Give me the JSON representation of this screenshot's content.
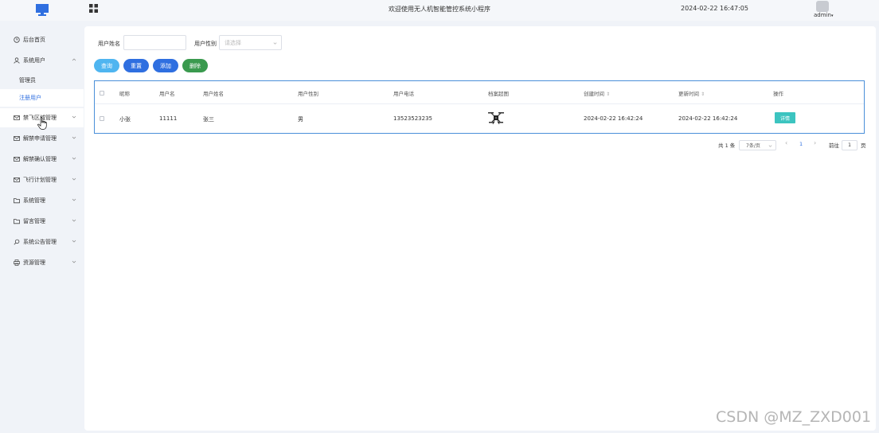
{
  "header": {
    "welcome": "欢迎使用无人机智能管控系统小程序",
    "datetime": "2024-02-22 16:47:05",
    "user": "admin",
    "user_caret": "▾"
  },
  "sidebar": {
    "items": [
      {
        "label": "后台首页",
        "icon": "clock-icon"
      },
      {
        "label": "系统用户",
        "icon": "user-icon"
      },
      {
        "label": "禁飞区域管理",
        "icon": "envelope-icon"
      },
      {
        "label": "解禁申请管理",
        "icon": "envelope-icon"
      },
      {
        "label": "解禁确认管理",
        "icon": "envelope-icon"
      },
      {
        "label": "飞行计划管理",
        "icon": "envelope-icon"
      },
      {
        "label": "系统管理",
        "icon": "folder-icon"
      },
      {
        "label": "留言管理",
        "icon": "folder-icon"
      },
      {
        "label": "系统公告管理",
        "icon": "search-icon"
      },
      {
        "label": "资源管理",
        "icon": "printer-icon"
      }
    ],
    "sub_items": [
      {
        "label": "管理员"
      },
      {
        "label": "注册用户"
      }
    ]
  },
  "search": {
    "name_label": "用户姓名",
    "name_value": "",
    "gender_label": "用户性别",
    "gender_placeholder": "请选择"
  },
  "buttons": {
    "query": "查询",
    "reset": "重置",
    "add": "添加",
    "delete": "删除"
  },
  "colors": {
    "query": "#4fb5f0",
    "reset": "#2f6fe0",
    "add": "#2f6fe0",
    "delete": "#3a9a4e",
    "accent": "#2f6fe0",
    "detail": "#3cc4c0"
  },
  "table": {
    "headers": [
      "昵称",
      "用户名",
      "用户姓名",
      "用户性别",
      "用户电话",
      "档案超图",
      "创建时间",
      "更新时间",
      "操作"
    ],
    "sort_indicator": "⇕",
    "rows": [
      {
        "nickname": "小张",
        "username": "11111",
        "name": "张三",
        "gender": "男",
        "phone": "13523523235",
        "image": "drone-image",
        "created": "2024-02-22 16:42:24",
        "updated": "2024-02-22 16:42:24",
        "action": "详情"
      }
    ]
  },
  "pagination": {
    "total": "共 1 条",
    "page_size": "7条/页",
    "prev": "‹",
    "current": "1",
    "next": "›",
    "goto_label": "前往",
    "goto_value": "1",
    "page_suffix": "页"
  },
  "watermark": "CSDN @MZ_ZXD001"
}
